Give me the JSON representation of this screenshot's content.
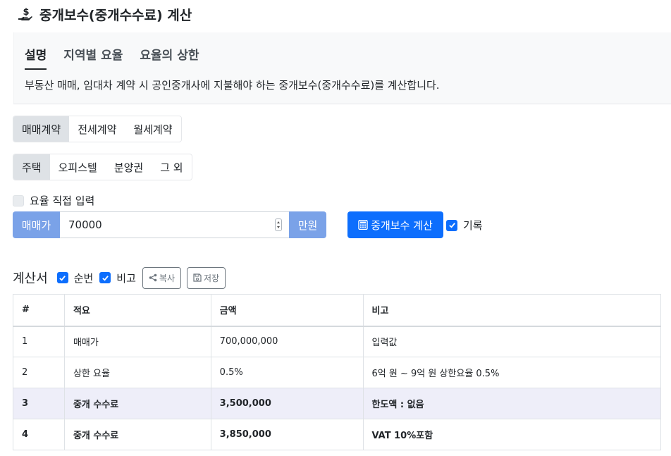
{
  "page": {
    "title": "중개보수(중개수수료) 계산",
    "title_icon": "hand-coin-icon"
  },
  "info": {
    "tabs": [
      {
        "label": "설명",
        "active": true
      },
      {
        "label": "지역별 요율",
        "active": false
      },
      {
        "label": "요율의 상한",
        "active": false
      }
    ],
    "description": "부동산 매매, 임대차 계약 시 공인중개사에 지불해야 하는 중개보수(중개수수료)를 계산합니다."
  },
  "contract_types": {
    "options": [
      "매매계약",
      "전세계약",
      "월세계약"
    ],
    "selected": "매매계약"
  },
  "property_types": {
    "options": [
      "주택",
      "오피스텔",
      "분양권",
      "그 외"
    ],
    "selected": "주택"
  },
  "manual_rate": {
    "label": "요율 직접 입력",
    "checked": false
  },
  "price": {
    "prefix": "매매가",
    "value": "70000",
    "suffix": "만원"
  },
  "calculate_button": {
    "label": "중개보수 계산",
    "icon": "calculator-icon"
  },
  "record": {
    "label": "기록",
    "checked": true
  },
  "sheet": {
    "title": "계산서",
    "options": [
      {
        "label": "순번",
        "checked": true
      },
      {
        "label": "비고",
        "checked": true
      }
    ],
    "copy_label": "복사",
    "save_label": "저장",
    "columns": [
      "#",
      "적요",
      "금액",
      "비고"
    ],
    "rows": [
      {
        "no": "1",
        "item": "매매가",
        "amount": "700,000,000",
        "note": "입력값",
        "bold": false,
        "highlight": false
      },
      {
        "no": "2",
        "item": "상한 요율",
        "amount": "0.5%",
        "note": "6억 원 ~ 9억 원 상한요율 0.5%",
        "bold": false,
        "highlight": false
      },
      {
        "no": "3",
        "item": "중개 수수료",
        "amount": "3,500,000",
        "note": "한도액 : 없음",
        "bold": true,
        "highlight": true
      },
      {
        "no": "4",
        "item": "중개 수수료",
        "amount": "3,850,000",
        "note": "VAT 10%포함",
        "bold": true,
        "highlight": false
      }
    ]
  },
  "colors": {
    "primary": "#0d6efd",
    "addon": "#7aa2e8",
    "highlight_row": "#eeeef9",
    "panel": "#f8f9fa"
  }
}
